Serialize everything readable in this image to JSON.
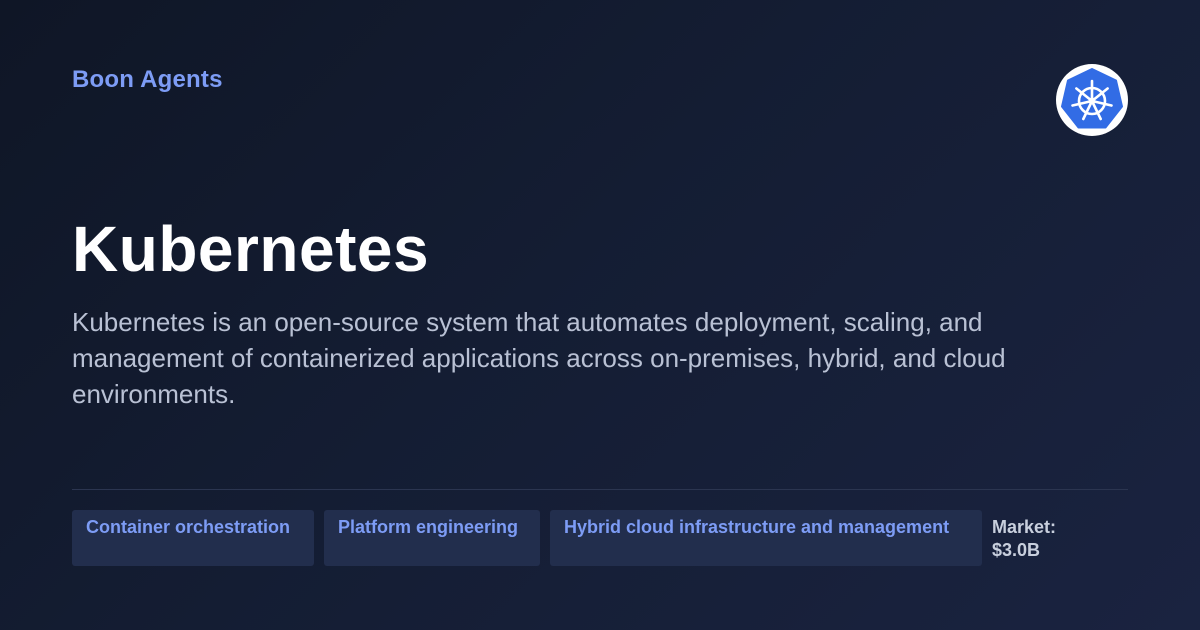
{
  "brand": {
    "name": "Boon Agents",
    "accent_color": "#7d9cf5"
  },
  "logo": {
    "icon": "kubernetes-helm-wheel-icon",
    "background_color": "#326ce5"
  },
  "hero": {
    "title": "Kubernetes",
    "description": "Kubernetes is an open-source system that automates deployment, scaling, and management of containerized applications across on-premises, hybrid, and cloud environments."
  },
  "tags": [
    {
      "label": "Container orchestration"
    },
    {
      "label": "Platform engineering"
    },
    {
      "label": "Hybrid cloud infrastructure and management"
    }
  ],
  "market": {
    "label": "Market: $3.0B"
  }
}
